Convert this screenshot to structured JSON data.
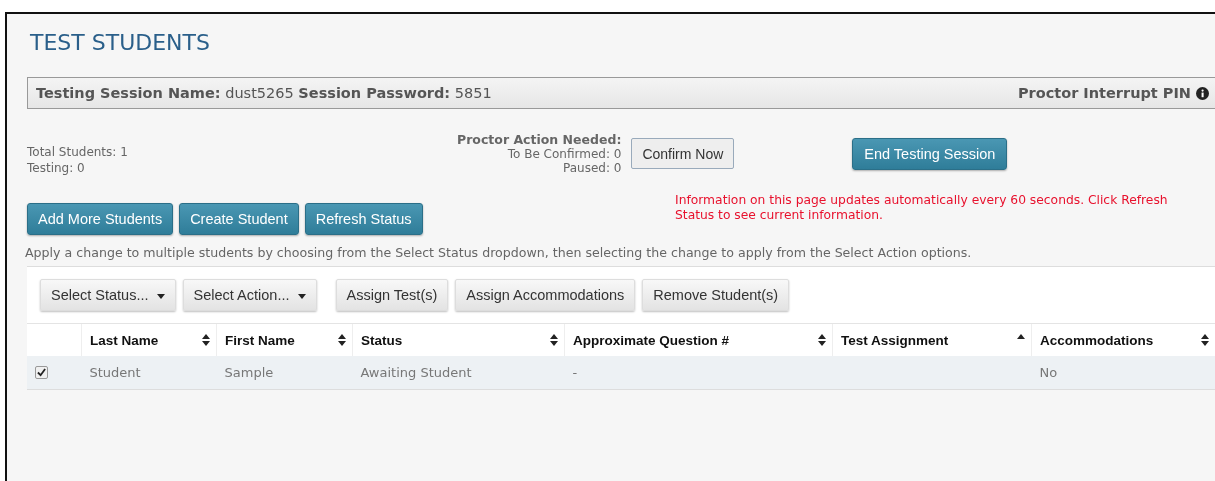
{
  "title": "TEST STUDENTS",
  "session_bar": {
    "text": "**Testing Session Name:** dust5265 **Session Password:** 5851",
    "pin_label": "Proctor Interrupt PIN"
  },
  "stats": [
    "Total Students: 1",
    "Testing: 0"
  ],
  "proctor_action": {
    "heading": "Proctor Action Needed:",
    "lines": [
      "To Be Confirmed: 0",
      "Paused: 0"
    ],
    "button": "Confirm Now"
  },
  "end_button": "End Testing Session",
  "action_buttons": [
    "Add More Students",
    "Create Student",
    "Refresh Status"
  ],
  "notice": "Information on this page updates automatically every 60 seconds. Click Refresh Status to see current information.",
  "help_text": "Apply a change to multiple students by choosing from the Select Status dropdown, then selecting the change to apply from the Select Action options.",
  "toolbar": [
    {
      "label": "Select Status...",
      "kind": "dropdown"
    },
    {
      "label": "Select Action...",
      "kind": "dropdown"
    },
    {
      "label": "Assign Test(s)",
      "kind": "button"
    },
    {
      "label": "Assign Accommodations",
      "kind": "button"
    },
    {
      "label": "Remove Student(s)",
      "kind": "button"
    }
  ],
  "table": {
    "columns": [
      {
        "label": "Last Name",
        "kind": "sortable"
      },
      {
        "label": "First Name",
        "kind": "sortable"
      },
      {
        "label": "Status",
        "kind": "sortable"
      },
      {
        "label": "Approximate Question #",
        "kind": "sortable"
      },
      {
        "label": "Test Assignment",
        "kind": "ascending"
      },
      {
        "label": "Accommodations",
        "kind": "sortable"
      }
    ],
    "rows": [
      {
        "checked": true,
        "cells": [
          "Student",
          "Sample",
          "Awaiting Student",
          "-",
          null,
          "No"
        ]
      }
    ]
  }
}
